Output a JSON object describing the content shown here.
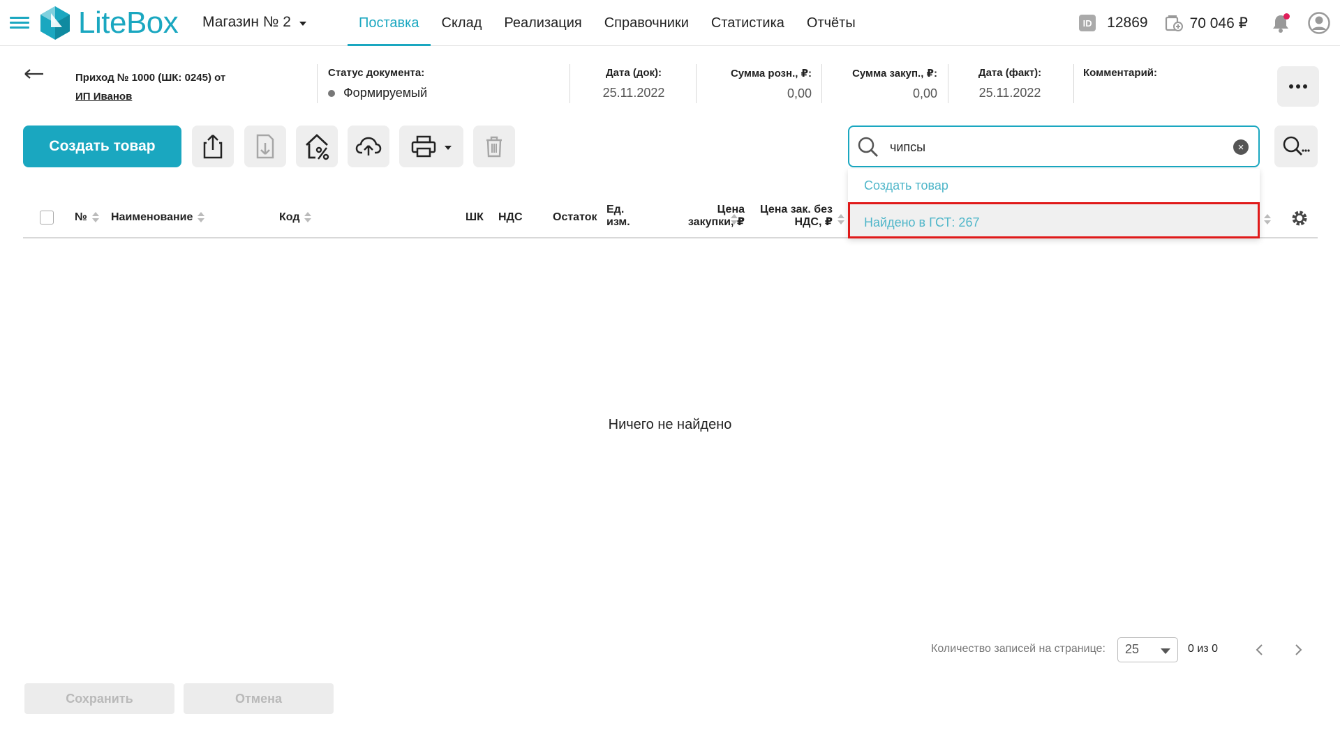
{
  "header": {
    "app_name": "LiteBox",
    "store": "Магазин № 2",
    "nav": [
      {
        "label": "Поставка",
        "active": true
      },
      {
        "label": "Склад"
      },
      {
        "label": "Реализация"
      },
      {
        "label": "Справочники"
      },
      {
        "label": "Статистика"
      },
      {
        "label": "Отчёты"
      }
    ],
    "account_id_badge": "ID",
    "account_id": "12869",
    "balance": "70 046 ₽",
    "has_notification": true,
    "accent_color": "#1aa7c0"
  },
  "document": {
    "title": "Приход № 1000 (ШК: 0245) от",
    "supplier": "ИП Иванов",
    "status_label": "Статус документа:",
    "status_value": "Формируемый",
    "date_doc_label": "Дата (док):",
    "date_doc_value": "25.11.2022",
    "retail_sum_label": "Сумма розн., ₽:",
    "retail_sum_value": "0,00",
    "purchase_sum_label": "Сумма закуп., ₽:",
    "purchase_sum_value": "0,00",
    "date_fact_label": "Дата (факт):",
    "date_fact_value": "25.11.2022",
    "comment_label": "Комментарий:",
    "comment_value": ""
  },
  "toolbar": {
    "create_label": "Создать товар",
    "icons": [
      "export-icon",
      "import-icon",
      "price-markup-icon",
      "cloud-upload-icon",
      "printer-icon",
      "trash-icon"
    ]
  },
  "search": {
    "value": "чипсы",
    "clear_symbol": "×",
    "dropdown": [
      {
        "label": "Создать товар"
      },
      {
        "label": "Найдено в ГСТ: 267",
        "highlighted": true
      }
    ],
    "highlight_color": "#e01a1a"
  },
  "table": {
    "columns": {
      "num": "№",
      "name": "Наименование",
      "code": "Код",
      "barcode": "ШК",
      "vat": "НДС",
      "stock": "Остаток",
      "unit_1": "Ед.",
      "unit_2": "изм.",
      "price_1": "Цена",
      "price_2": "закупки, ₽",
      "price_novat_1": "Цена зак. без",
      "price_novat_2": "НДС, ₽"
    },
    "empty_message": "Ничего не найдено"
  },
  "pagination": {
    "label": "Количество записей на странице:",
    "page_size": "25",
    "count": "0 из 0"
  },
  "footer": {
    "save_label": "Сохранить",
    "cancel_label": "Отмена"
  }
}
